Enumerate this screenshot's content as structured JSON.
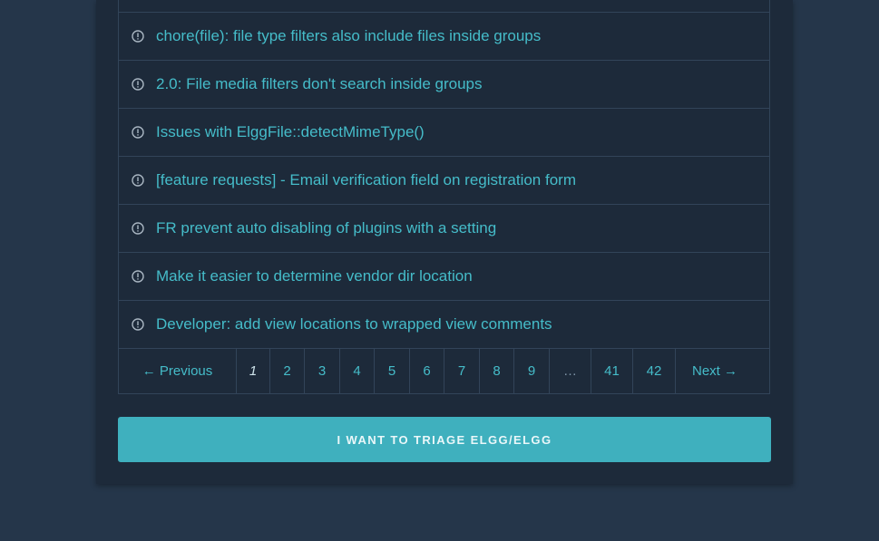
{
  "issues": [
    {
      "title": ""
    },
    {
      "title": "chore(file): file type filters also include files inside groups"
    },
    {
      "title": "2.0: File media filters don't search inside groups"
    },
    {
      "title": "Issues with ElggFile::detectMimeType()"
    },
    {
      "title": "[feature requests] - Email verification field on registration form"
    },
    {
      "title": "FR prevent auto disabling of plugins with a setting"
    },
    {
      "title": "Make it easier to determine vendor dir location"
    },
    {
      "title": "Developer: add view locations to wrapped view comments"
    }
  ],
  "pagination": {
    "previous": "← Previous",
    "pages": [
      "1",
      "2",
      "3",
      "4",
      "5",
      "6",
      "7",
      "8",
      "9"
    ],
    "gap": "…",
    "tail_pages": [
      "41",
      "42"
    ],
    "next": "Next →",
    "current": "1"
  },
  "triage_button": {
    "label": "I WANT TO TRIAGE ELGG/ELGG"
  },
  "icons": {
    "issue_icon": "issue-opened-icon"
  },
  "colors": {
    "background": "#25364a",
    "panel": "#1d2a3a",
    "link": "#45bcc9",
    "button": "#3fb0be"
  }
}
